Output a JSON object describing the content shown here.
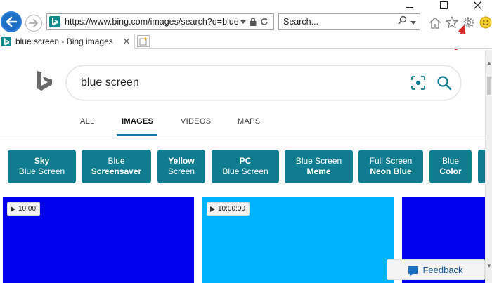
{
  "browser": {
    "address_url": "https://www.bing.com/images/search?q=blue",
    "search_placeholder": "Search...",
    "tab_title": "blue screen - Bing images",
    "tab_close": "✕"
  },
  "page": {
    "query": "blue screen",
    "vertical_tabs": [
      {
        "label": "ALL"
      },
      {
        "label": "IMAGES"
      },
      {
        "label": "VIDEOS"
      },
      {
        "label": "MAPS"
      }
    ],
    "active_tab": "IMAGES",
    "chips": [
      {
        "line1": "Sky",
        "line2": "Blue Screen"
      },
      {
        "line1": "Blue",
        "line2": "Screensaver"
      },
      {
        "line1": "Yellow",
        "line2": "Screen"
      },
      {
        "line1": "PC",
        "line2": "Blue Screen"
      },
      {
        "line1": "Blue Screen",
        "line2": "Meme"
      },
      {
        "line1": "Full Screen",
        "line2": "Neon Blue"
      },
      {
        "line1": "Blue",
        "line2": "Color"
      }
    ],
    "tiles": [
      {
        "duration": "10:00",
        "color": "#0000ee"
      },
      {
        "duration": "10:00:00",
        "color": "#00b3ff"
      },
      {
        "duration": "",
        "color": "#0000ee"
      }
    ],
    "feedback_label": "Feedback"
  },
  "colors": {
    "chip_bg": "#0f7d8f",
    "accent": "#1a73a8",
    "bing_teal": "#0e8a8a",
    "annotation_arrow": "#d62a2a"
  },
  "icons": [
    "back-arrow-icon",
    "forward-arrow-icon",
    "bing-favicon-icon",
    "dropdown-icon",
    "lock-icon",
    "refresh-icon",
    "search-icon",
    "home-icon",
    "star-icon",
    "gear-icon",
    "smiley-icon",
    "visual-search-icon",
    "play-icon",
    "feedback-icon"
  ]
}
